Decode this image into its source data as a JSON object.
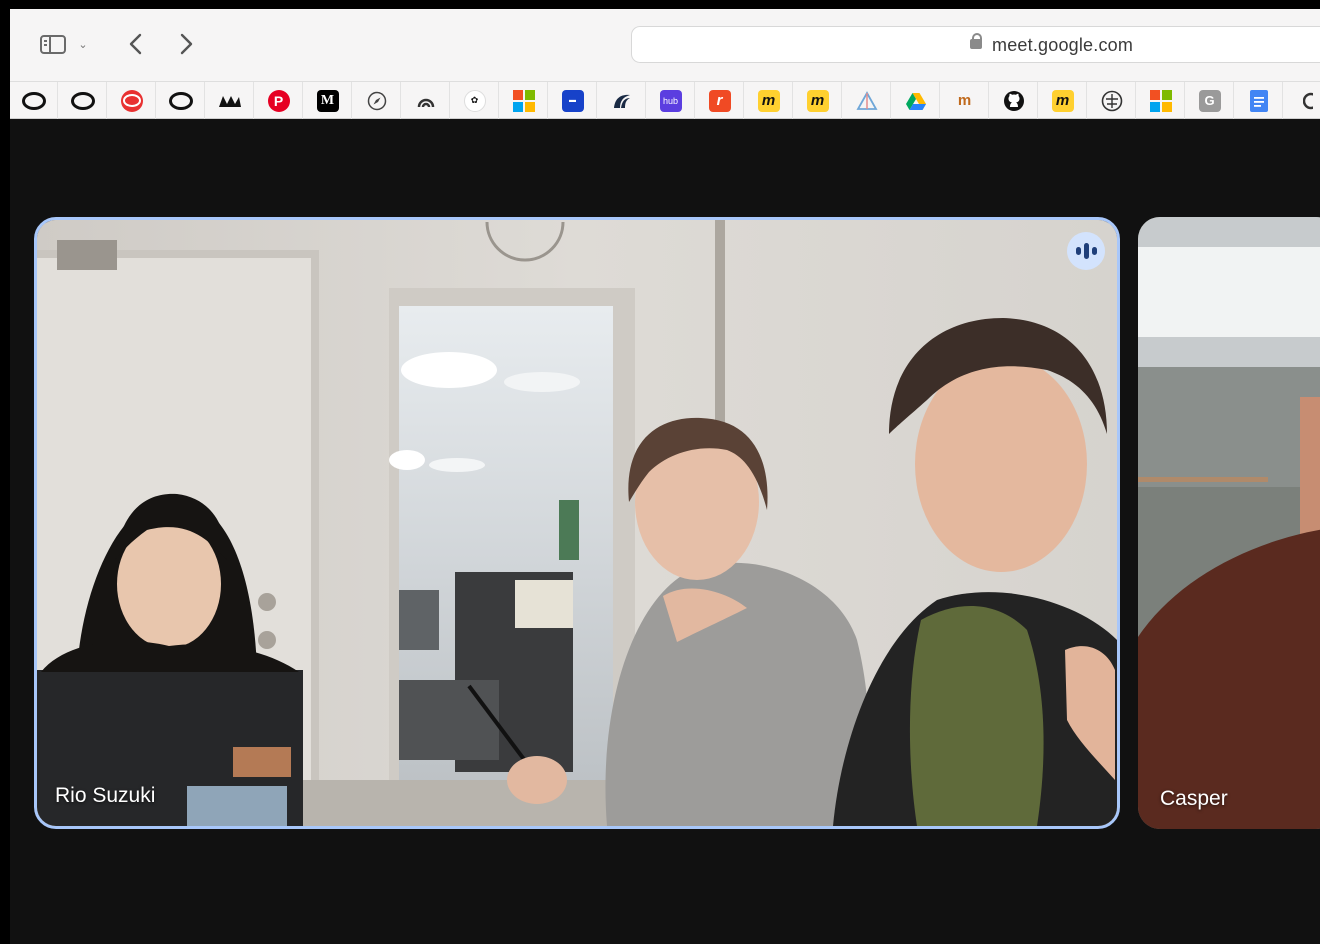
{
  "browser": {
    "url": "meet.google.com",
    "icons": {
      "sidebar": "sidebar-icon",
      "back": "chevron-left-icon",
      "forward": "chevron-right-icon",
      "lock": "lock-icon"
    }
  },
  "bookmarks": [
    {
      "name": "ring-bookmark-1",
      "glyph": ""
    },
    {
      "name": "ring-bookmark-2",
      "glyph": ""
    },
    {
      "name": "red-ring-bookmark",
      "glyph": ""
    },
    {
      "name": "ring-bookmark-3",
      "glyph": ""
    },
    {
      "name": "black-logo-bookmark",
      "glyph": ""
    },
    {
      "name": "pinterest-bookmark",
      "glyph": "P"
    },
    {
      "name": "medium-bookmark",
      "glyph": "M"
    },
    {
      "name": "compass-bookmark",
      "glyph": ""
    },
    {
      "name": "arc-bookmark",
      "glyph": ""
    },
    {
      "name": "circle-logo-bookmark",
      "glyph": ""
    },
    {
      "name": "microsoft-bookmark-1",
      "glyph": ""
    },
    {
      "name": "blue-box-bookmark",
      "glyph": ""
    },
    {
      "name": "wave-bookmark",
      "glyph": ""
    },
    {
      "name": "hub-bookmark",
      "glyph": "hub"
    },
    {
      "name": "red-r-bookmark",
      "glyph": "r"
    },
    {
      "name": "miro-bookmark-1",
      "glyph": "m"
    },
    {
      "name": "miro-bookmark-2",
      "glyph": "m"
    },
    {
      "name": "triangle-bookmark",
      "glyph": ""
    },
    {
      "name": "google-drive-bookmark",
      "glyph": ""
    },
    {
      "name": "m-logo-bookmark",
      "glyph": "m"
    },
    {
      "name": "github-bookmark",
      "glyph": ""
    },
    {
      "name": "miro-bookmark-3",
      "glyph": "m"
    },
    {
      "name": "shell-bookmark",
      "glyph": ""
    },
    {
      "name": "microsoft-bookmark-2",
      "glyph": ""
    },
    {
      "name": "grammarly-bookmark",
      "glyph": "G"
    },
    {
      "name": "google-docs-bookmark",
      "glyph": ""
    }
  ],
  "meeting": {
    "main_tile": {
      "participant_name": "Rio Suzuki",
      "speaking": true
    },
    "side_tile": {
      "participant_name": "Casper"
    }
  },
  "colors": {
    "stage_bg": "#0d0d0d",
    "active_border": "#a8c7fa",
    "speaking_badge": "#d3e3fd"
  }
}
